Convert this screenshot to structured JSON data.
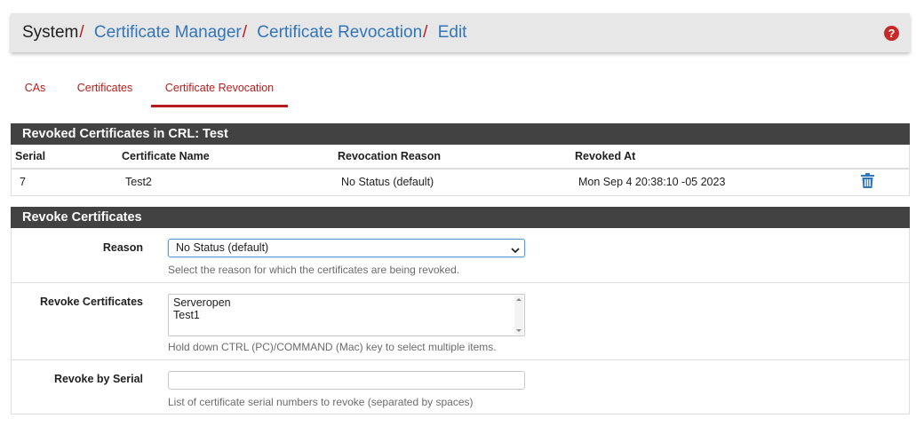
{
  "breadcrumb": {
    "system": "System",
    "sep": "/",
    "items": [
      "Certificate Manager",
      "Certificate Revocation",
      "Edit"
    ]
  },
  "help_icon": "question-circle-icon",
  "tabs": [
    {
      "label": "CAs",
      "active": false
    },
    {
      "label": "Certificates",
      "active": false
    },
    {
      "label": "Certificate Revocation",
      "active": true
    }
  ],
  "revoked_panel": {
    "title": "Revoked Certificates in CRL: Test",
    "columns": [
      "Serial",
      "Certificate Name",
      "Revocation Reason",
      "Revoked At"
    ],
    "rows": [
      {
        "serial": "7",
        "name": "Test2",
        "reason": "No Status (default)",
        "revoked_at": "Mon Sep 4 20:38:10 -05 2023",
        "action_icon": "trash-icon"
      }
    ]
  },
  "revoke_panel": {
    "title": "Revoke Certificates",
    "reason": {
      "label": "Reason",
      "selected": "No Status (default)",
      "help": "Select the reason for which the certificates are being revoked."
    },
    "certificates": {
      "label": "Revoke Certificates",
      "options": [
        "Serveropen",
        "Test1"
      ],
      "help": "Hold down CTRL (PC)/COMMAND (Mac) key to select multiple items."
    },
    "serial": {
      "label": "Revoke by Serial",
      "value": "",
      "help": "List of certificate serial numbers to revoke (separated by spaces)"
    }
  },
  "colors": {
    "accent": "#b71c1c",
    "link": "#3275ba",
    "panel_header": "#424242",
    "trash": "#3275ba"
  }
}
